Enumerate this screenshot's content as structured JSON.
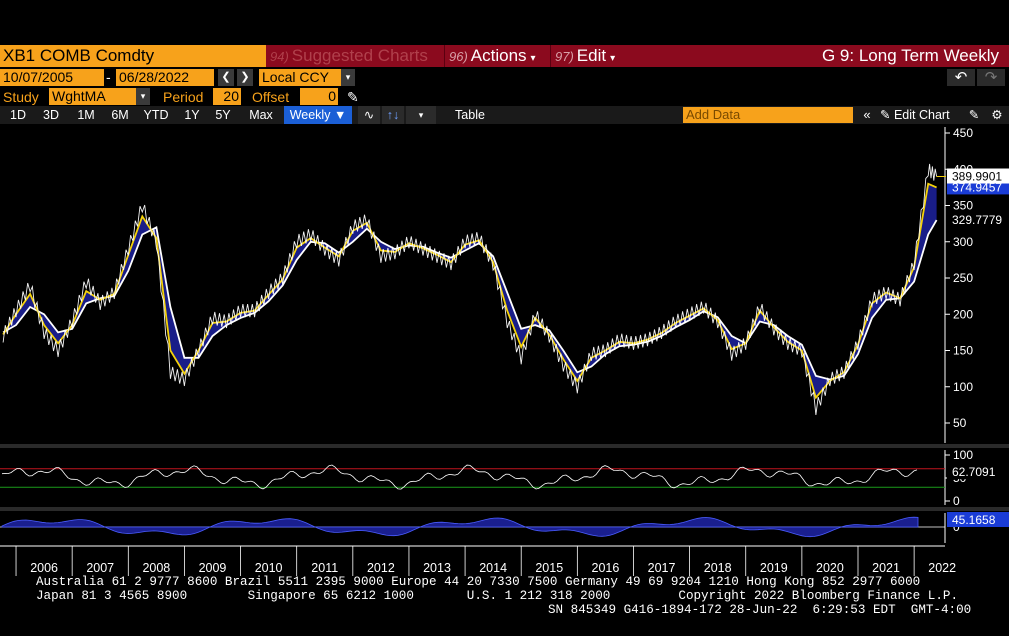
{
  "header": {
    "ticker": "XB1 COMB Comdty",
    "suggested_num": "94)",
    "suggested_label": "Suggested Charts",
    "actions_num": "96)",
    "actions_label": "Actions",
    "edit_num": "97)",
    "edit_label": "Edit",
    "title": "G 9: Long Term Weekly"
  },
  "range": {
    "start_date": "10/07/2005",
    "separator": "-",
    "end_date": "06/28/2022",
    "currency": "Local CCY"
  },
  "study": {
    "label": "Study",
    "value": "WghtMA",
    "period_label": "Period",
    "period_value": "20",
    "offset_label": "Offset",
    "offset_value": "0"
  },
  "toolbar": {
    "periods": [
      "1D",
      "3D",
      "1M",
      "6M",
      "YTD",
      "1Y",
      "5Y",
      "Max"
    ],
    "frequency": "Weekly",
    "table_label": "Table",
    "add_data_placeholder": "Add Data",
    "edit_chart_label": "Edit Chart"
  },
  "price_panel": {
    "y_ticks": [
      "450",
      "400",
      "350",
      "300",
      "250",
      "200",
      "150",
      "100",
      "50"
    ],
    "last_price": "389.9901",
    "ma_short_value": "374.9457",
    "ma_long_value": "329.7779"
  },
  "rsi_panel": {
    "y_ticks": [
      "100",
      "50",
      "0"
    ],
    "last_value": "62.7091"
  },
  "macd_panel": {
    "y_ticks": [
      "0"
    ],
    "last_value": "45.1658"
  },
  "x_axis": {
    "years": [
      "2006",
      "2007",
      "2008",
      "2009",
      "2010",
      "2011",
      "2012",
      "2013",
      "2014",
      "2015",
      "2016",
      "2017",
      "2018",
      "2019",
      "2020",
      "2021",
      "2022"
    ]
  },
  "footer": {
    "line1": "Australia 61 2 9777 8600 Brazil 5511 2395 9000 Europe 44 20 7330 7500 Germany 49 69 9204 1210 Hong Kong 852 2977 6000",
    "line2": "Japan 81 3 4565 8900        Singapore 65 6212 1000       U.S. 1 212 318 2000         Copyright 2022 Bloomberg Finance L.P.",
    "line3": "SN 845349 G416-1894-172 28-Jun-22  6:29:53 EDT  GMT-4:00"
  },
  "colors": {
    "bloomberg_orange": "#f7a21b",
    "header_red": "#8b0a1e",
    "price_line": "#ffffff",
    "ma_short": "#f5d20a",
    "ma_long": "#ffffff",
    "fill_band": "#1a1f8f",
    "overbought": "#c0141e",
    "oversold": "#1a9a1a",
    "last_price_box": "#ffffff",
    "ma_short_box": "#1a3cd6"
  },
  "chart_data": {
    "type": "line",
    "title": "",
    "xlabel": "",
    "ylabel": "",
    "ylim": [
      25,
      460
    ],
    "x": [
      2005.77,
      2006.0,
      2006.25,
      2006.5,
      2006.75,
      2007.0,
      2007.25,
      2007.5,
      2007.75,
      2008.0,
      2008.25,
      2008.5,
      2008.75,
      2009.0,
      2009.25,
      2009.5,
      2009.75,
      2010.0,
      2010.25,
      2010.5,
      2010.75,
      2011.0,
      2011.25,
      2011.5,
      2011.75,
      2012.0,
      2012.25,
      2012.5,
      2012.75,
      2013.0,
      2013.25,
      2013.5,
      2013.75,
      2014.0,
      2014.25,
      2014.5,
      2014.75,
      2015.0,
      2015.25,
      2015.5,
      2015.75,
      2016.0,
      2016.25,
      2016.5,
      2016.75,
      2017.0,
      2017.25,
      2017.5,
      2017.75,
      2018.0,
      2018.25,
      2018.5,
      2018.75,
      2019.0,
      2019.25,
      2019.5,
      2019.75,
      2020.0,
      2020.25,
      2020.5,
      2020.75,
      2021.0,
      2021.25,
      2021.5,
      2021.75,
      2022.0,
      2022.25,
      2022.4
    ],
    "series": [
      {
        "values": [
          170,
          205,
          240,
          175,
          150,
          190,
          245,
          215,
          230,
          290,
          350,
          300,
          120,
          110,
          150,
          195,
          190,
          205,
          205,
          230,
          250,
          300,
          310,
          290,
          275,
          320,
          330,
          280,
          285,
          300,
          290,
          280,
          270,
          300,
          305,
          270,
          190,
          140,
          200,
          170,
          130,
          100,
          145,
          150,
          165,
          160,
          165,
          175,
          190,
          200,
          210,
          190,
          145,
          160,
          210,
          180,
          160,
          150,
          70,
          110,
          120,
          160,
          220,
          230,
          220,
          270,
          400,
          390
        ]
      },
      {
        "values": [
          172,
          200,
          228,
          185,
          160,
          185,
          232,
          220,
          228,
          282,
          335,
          305,
          150,
          118,
          150,
          188,
          190,
          202,
          205,
          227,
          248,
          292,
          305,
          292,
          280,
          315,
          326,
          288,
          286,
          298,
          291,
          282,
          272,
          296,
          302,
          272,
          205,
          155,
          195,
          172,
          138,
          108,
          140,
          150,
          162,
          160,
          165,
          174,
          188,
          198,
          208,
          192,
          152,
          160,
          205,
          182,
          162,
          150,
          85,
          108,
          120,
          158,
          215,
          230,
          222,
          265,
          380,
          374.9
        ]
      },
      {
        "values": [
          175,
          185,
          210,
          200,
          175,
          180,
          215,
          222,
          225,
          260,
          310,
          320,
          210,
          140,
          140,
          170,
          185,
          195,
          202,
          218,
          240,
          275,
          300,
          298,
          285,
          300,
          318,
          300,
          290,
          295,
          293,
          285,
          278,
          288,
          298,
          280,
          230,
          180,
          185,
          178,
          150,
          120,
          128,
          145,
          156,
          158,
          162,
          170,
          182,
          192,
          204,
          196,
          170,
          160,
          190,
          185,
          170,
          158,
          115,
          110,
          115,
          145,
          195,
          220,
          222,
          245,
          310,
          329.8
        ]
      }
    ],
    "rsi_ylim": [
      0,
      100
    ],
    "macd_zero": 0
  }
}
